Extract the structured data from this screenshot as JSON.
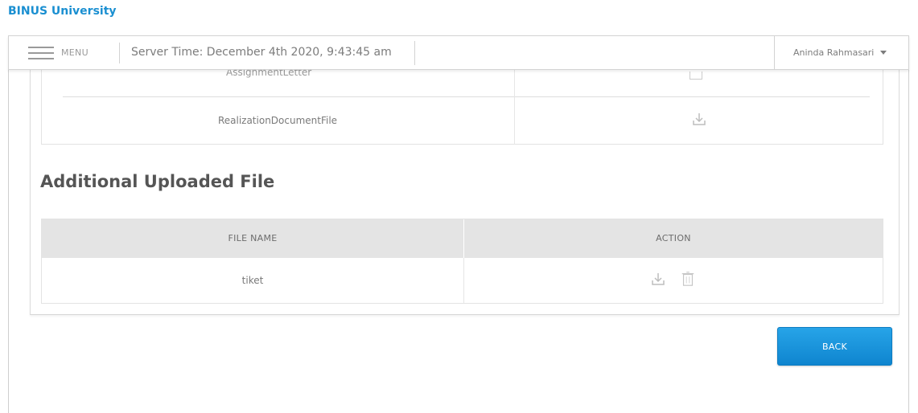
{
  "brand": {
    "name": "BINUS University"
  },
  "topbar": {
    "menu_label": "MENU",
    "server_time": "Server Time: December 4th 2020, 9:43:45 am",
    "user_name": "Aninda Rahmasari"
  },
  "documents_table": {
    "rows": [
      {
        "name": "AssignmentLetter"
      },
      {
        "name": "RealizationDocumentFile"
      }
    ]
  },
  "additional_files": {
    "title": "Additional Uploaded File",
    "columns": [
      "FILE NAME",
      "ACTION"
    ],
    "rows": [
      {
        "file_name": "tiket"
      }
    ]
  },
  "actions": {
    "back_label": "BACK"
  },
  "colors": {
    "brand": "#1a8fd1",
    "button": "#1591d8",
    "header_bg": "#e4e4e4"
  }
}
